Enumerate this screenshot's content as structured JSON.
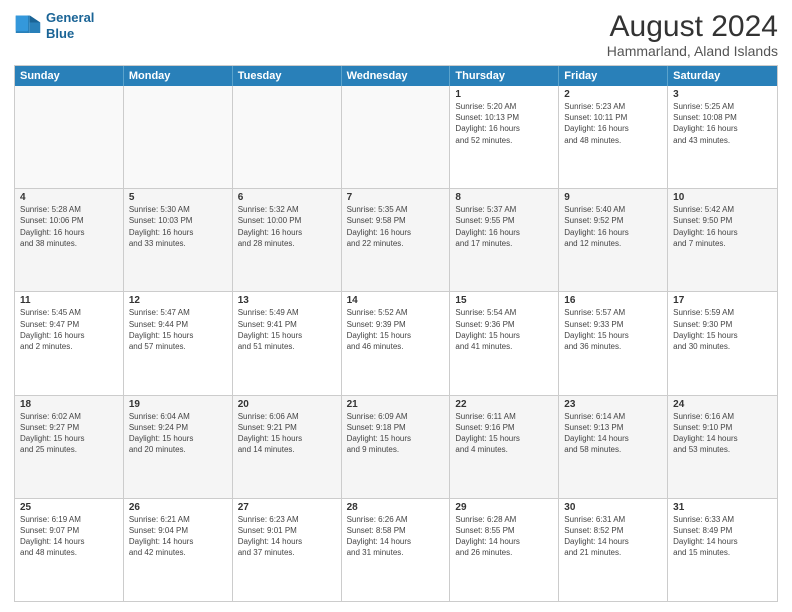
{
  "header": {
    "logo_line1": "General",
    "logo_line2": "Blue",
    "month": "August 2024",
    "location": "Hammarland, Aland Islands"
  },
  "days_of_week": [
    "Sunday",
    "Monday",
    "Tuesday",
    "Wednesday",
    "Thursday",
    "Friday",
    "Saturday"
  ],
  "weeks": [
    [
      {
        "day": "",
        "empty": true
      },
      {
        "day": "",
        "empty": true
      },
      {
        "day": "",
        "empty": true
      },
      {
        "day": "",
        "empty": true
      },
      {
        "day": "1",
        "text": "Sunrise: 5:20 AM\nSunset: 10:13 PM\nDaylight: 16 hours\nand 52 minutes."
      },
      {
        "day": "2",
        "text": "Sunrise: 5:23 AM\nSunset: 10:11 PM\nDaylight: 16 hours\nand 48 minutes."
      },
      {
        "day": "3",
        "text": "Sunrise: 5:25 AM\nSunset: 10:08 PM\nDaylight: 16 hours\nand 43 minutes."
      }
    ],
    [
      {
        "day": "4",
        "text": "Sunrise: 5:28 AM\nSunset: 10:06 PM\nDaylight: 16 hours\nand 38 minutes."
      },
      {
        "day": "5",
        "text": "Sunrise: 5:30 AM\nSunset: 10:03 PM\nDaylight: 16 hours\nand 33 minutes."
      },
      {
        "day": "6",
        "text": "Sunrise: 5:32 AM\nSunset: 10:00 PM\nDaylight: 16 hours\nand 28 minutes."
      },
      {
        "day": "7",
        "text": "Sunrise: 5:35 AM\nSunset: 9:58 PM\nDaylight: 16 hours\nand 22 minutes."
      },
      {
        "day": "8",
        "text": "Sunrise: 5:37 AM\nSunset: 9:55 PM\nDaylight: 16 hours\nand 17 minutes."
      },
      {
        "day": "9",
        "text": "Sunrise: 5:40 AM\nSunset: 9:52 PM\nDaylight: 16 hours\nand 12 minutes."
      },
      {
        "day": "10",
        "text": "Sunrise: 5:42 AM\nSunset: 9:50 PM\nDaylight: 16 hours\nand 7 minutes."
      }
    ],
    [
      {
        "day": "11",
        "text": "Sunrise: 5:45 AM\nSunset: 9:47 PM\nDaylight: 16 hours\nand 2 minutes."
      },
      {
        "day": "12",
        "text": "Sunrise: 5:47 AM\nSunset: 9:44 PM\nDaylight: 15 hours\nand 57 minutes."
      },
      {
        "day": "13",
        "text": "Sunrise: 5:49 AM\nSunset: 9:41 PM\nDaylight: 15 hours\nand 51 minutes."
      },
      {
        "day": "14",
        "text": "Sunrise: 5:52 AM\nSunset: 9:39 PM\nDaylight: 15 hours\nand 46 minutes."
      },
      {
        "day": "15",
        "text": "Sunrise: 5:54 AM\nSunset: 9:36 PM\nDaylight: 15 hours\nand 41 minutes."
      },
      {
        "day": "16",
        "text": "Sunrise: 5:57 AM\nSunset: 9:33 PM\nDaylight: 15 hours\nand 36 minutes."
      },
      {
        "day": "17",
        "text": "Sunrise: 5:59 AM\nSunset: 9:30 PM\nDaylight: 15 hours\nand 30 minutes."
      }
    ],
    [
      {
        "day": "18",
        "text": "Sunrise: 6:02 AM\nSunset: 9:27 PM\nDaylight: 15 hours\nand 25 minutes."
      },
      {
        "day": "19",
        "text": "Sunrise: 6:04 AM\nSunset: 9:24 PM\nDaylight: 15 hours\nand 20 minutes."
      },
      {
        "day": "20",
        "text": "Sunrise: 6:06 AM\nSunset: 9:21 PM\nDaylight: 15 hours\nand 14 minutes."
      },
      {
        "day": "21",
        "text": "Sunrise: 6:09 AM\nSunset: 9:18 PM\nDaylight: 15 hours\nand 9 minutes."
      },
      {
        "day": "22",
        "text": "Sunrise: 6:11 AM\nSunset: 9:16 PM\nDaylight: 15 hours\nand 4 minutes."
      },
      {
        "day": "23",
        "text": "Sunrise: 6:14 AM\nSunset: 9:13 PM\nDaylight: 14 hours\nand 58 minutes."
      },
      {
        "day": "24",
        "text": "Sunrise: 6:16 AM\nSunset: 9:10 PM\nDaylight: 14 hours\nand 53 minutes."
      }
    ],
    [
      {
        "day": "25",
        "text": "Sunrise: 6:19 AM\nSunset: 9:07 PM\nDaylight: 14 hours\nand 48 minutes."
      },
      {
        "day": "26",
        "text": "Sunrise: 6:21 AM\nSunset: 9:04 PM\nDaylight: 14 hours\nand 42 minutes."
      },
      {
        "day": "27",
        "text": "Sunrise: 6:23 AM\nSunset: 9:01 PM\nDaylight: 14 hours\nand 37 minutes."
      },
      {
        "day": "28",
        "text": "Sunrise: 6:26 AM\nSunset: 8:58 PM\nDaylight: 14 hours\nand 31 minutes."
      },
      {
        "day": "29",
        "text": "Sunrise: 6:28 AM\nSunset: 8:55 PM\nDaylight: 14 hours\nand 26 minutes."
      },
      {
        "day": "30",
        "text": "Sunrise: 6:31 AM\nSunset: 8:52 PM\nDaylight: 14 hours\nand 21 minutes."
      },
      {
        "day": "31",
        "text": "Sunrise: 6:33 AM\nSunset: 8:49 PM\nDaylight: 14 hours\nand 15 minutes."
      }
    ]
  ]
}
